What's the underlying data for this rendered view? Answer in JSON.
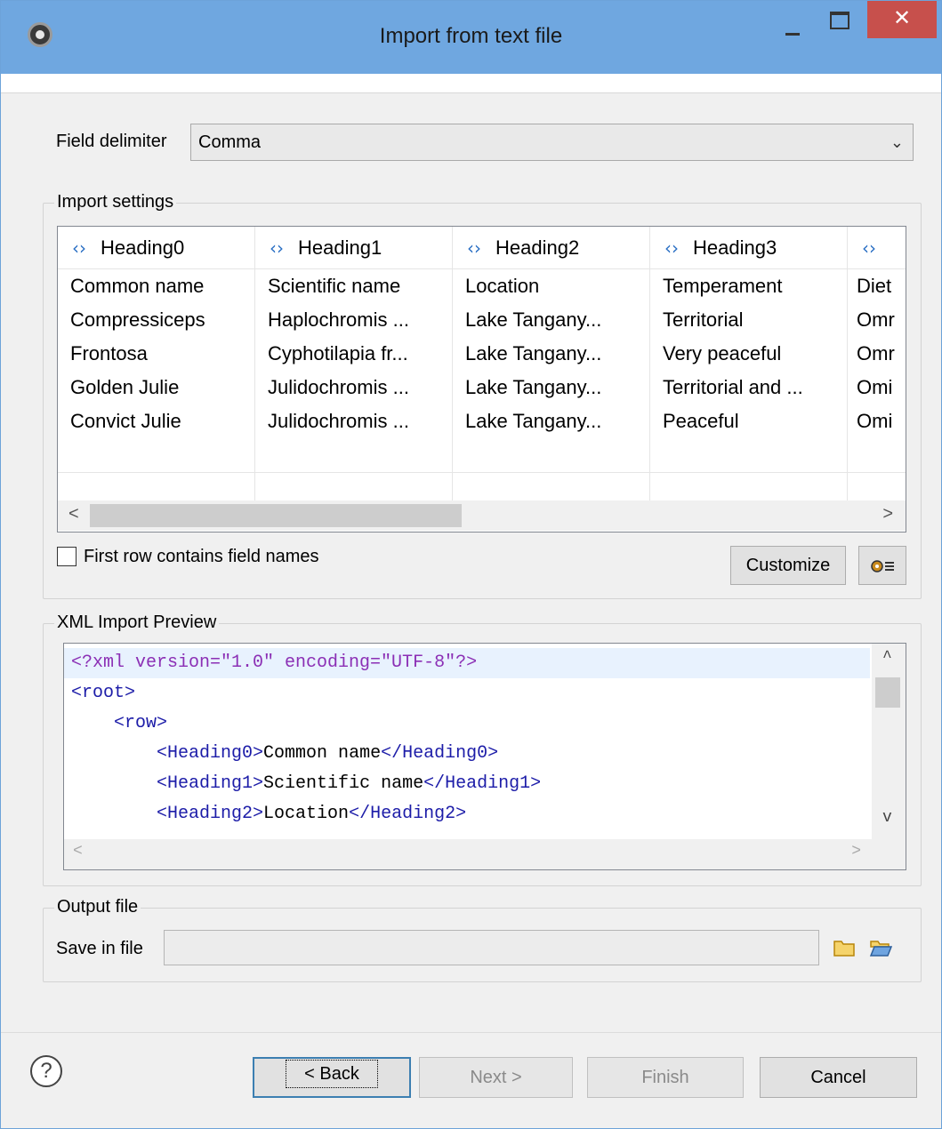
{
  "window": {
    "title": "Import from text file",
    "close_glyph": "✕"
  },
  "delimiter": {
    "label": "Field delimiter",
    "value": "Comma"
  },
  "import_settings": {
    "title": "Import settings",
    "headers": [
      "Heading0",
      "Heading1",
      "Heading2",
      "Heading3",
      ""
    ],
    "rows": [
      [
        "Common name",
        "Scientific name",
        "Location",
        "Temperament",
        "Diet"
      ],
      [
        "Compressiceps",
        "Haplochromis ...",
        "Lake Tangany...",
        "Territorial",
        "Omr"
      ],
      [
        "Frontosa",
        "Cyphotilapia fr...",
        "Lake Tangany...",
        "Very peaceful",
        "Omr"
      ],
      [
        "Golden Julie",
        "Julidochromis ...",
        "Lake Tangany...",
        "Territorial and ...",
        "Omi"
      ],
      [
        "Convict Julie",
        "Julidochromis ...",
        "Lake Tangany...",
        "Peaceful",
        "Omi"
      ]
    ],
    "first_row_label": "First row contains field names",
    "first_row_checked": false,
    "customize_label": "Customize"
  },
  "xml_preview": {
    "title": "XML Import Preview",
    "lines": [
      {
        "pi": "<?xml version=\"1.0\" encoding=\"UTF-8\"?>"
      },
      {
        "indent": "",
        "open": "<root>",
        "text": "",
        "close": ""
      },
      {
        "indent": "    ",
        "open": "<row>",
        "text": "",
        "close": ""
      },
      {
        "indent": "        ",
        "open": "<Heading0>",
        "text": "Common name",
        "close": "</Heading0>"
      },
      {
        "indent": "        ",
        "open": "<Heading1>",
        "text": "Scientific name",
        "close": "</Heading1>"
      },
      {
        "indent": "        ",
        "open": "<Heading2>",
        "text": "Location",
        "close": "</Heading2>"
      }
    ]
  },
  "output": {
    "title": "Output file",
    "save_label": "Save in file",
    "save_value": ""
  },
  "footer": {
    "back": "< Back",
    "next": "Next >",
    "finish": "Finish",
    "cancel": "Cancel"
  }
}
